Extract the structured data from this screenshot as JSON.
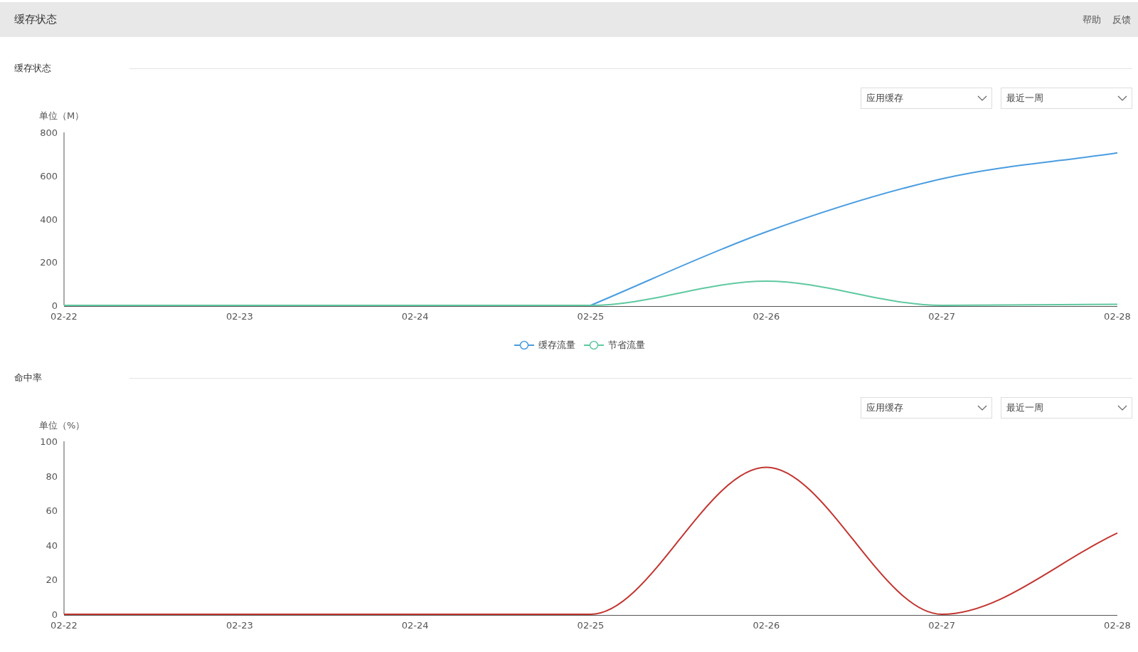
{
  "header": {
    "title": "缓存状态",
    "links": [
      "帮助",
      "反馈"
    ]
  },
  "sections": [
    {
      "title": "缓存状态",
      "filters": [
        {
          "value": "应用缓存"
        },
        {
          "value": "最近一周"
        }
      ],
      "chart_data": {
        "type": "line",
        "ylabel": "单位（M）",
        "categories": [
          "02-22",
          "02-23",
          "02-24",
          "02-25",
          "02-26",
          "02-27",
          "02-28"
        ],
        "ylim": [
          0,
          800
        ],
        "yticks": [
          0,
          200,
          400,
          600,
          800
        ],
        "series": [
          {
            "name": "缓存流量",
            "color": "#4a9de0",
            "values": [
              null,
              null,
              null,
              0,
              340,
              585,
              705
            ]
          },
          {
            "name": "节省流量",
            "color": "#5fc9a0",
            "values": [
              0,
              0,
              0,
              0,
              112,
              0,
              5
            ]
          }
        ]
      }
    },
    {
      "title": "命中率",
      "filters": [
        {
          "value": "应用缓存"
        },
        {
          "value": "最近一周"
        }
      ],
      "chart_data": {
        "type": "line",
        "ylabel": "单位（%）",
        "categories": [
          "02-22",
          "02-23",
          "02-24",
          "02-25",
          "02-26",
          "02-27",
          "02-28"
        ],
        "ylim": [
          0,
          100
        ],
        "yticks": [
          0,
          20,
          40,
          60,
          80,
          100
        ],
        "series": [
          {
            "color": "#c23531",
            "values": [
              0,
              0,
              0,
              0,
              85,
              0,
              47
            ]
          }
        ]
      }
    }
  ]
}
